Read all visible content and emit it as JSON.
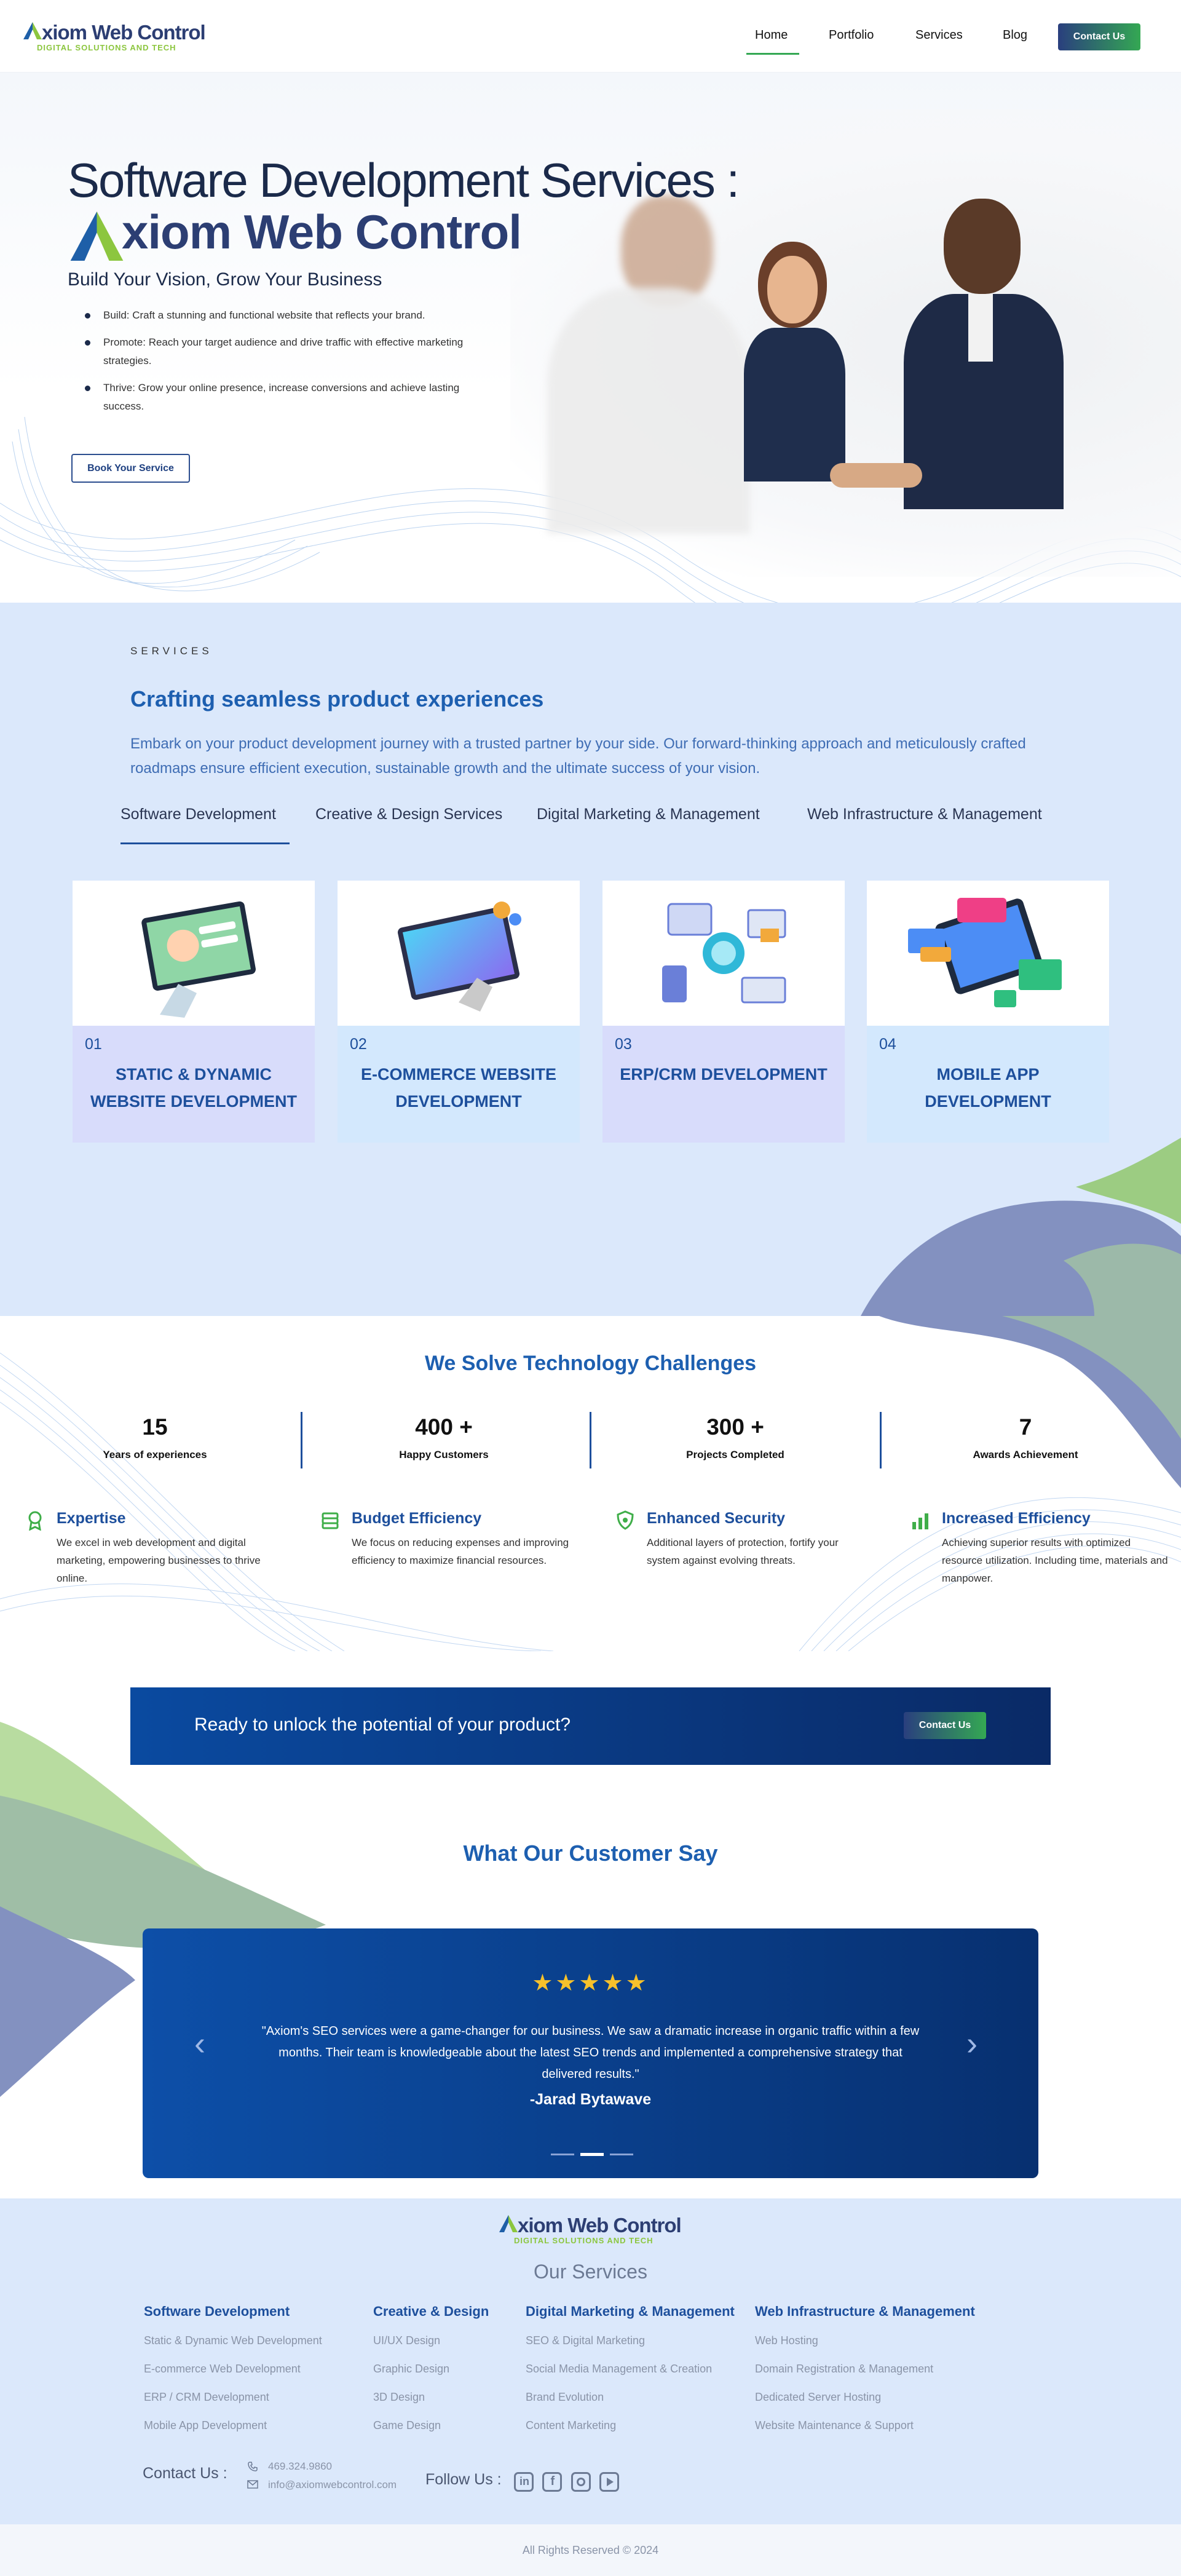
{
  "brand": {
    "name_first": "A",
    "name_rest": "xiom Web Control",
    "tagline": "DIGITAL SOLUTIONS AND TECH"
  },
  "nav": {
    "items": [
      "Home",
      "Portfolio",
      "Services",
      "Blog"
    ],
    "active": "Home",
    "contact_label": "Contact Us"
  },
  "hero": {
    "title_line1": "Software Development Services :",
    "title_brand": "xiom Web Control",
    "subtitle": "Build Your Vision, Grow Your Business",
    "bullets": [
      "Build: Craft a stunning and functional website that reflects your brand.",
      "Promote: Reach your target audience and drive traffic with effective marketing strategies.",
      "Thrive: Grow your online presence, increase conversions and achieve lasting success."
    ],
    "button": "Book Your Service"
  },
  "services": {
    "eyebrow": "SERVICES",
    "heading": "Crafting seamless product experiences",
    "description": "Embark on your product development journey with a trusted partner by your side. Our forward-thinking approach and meticulously crafted roadmaps ensure efficient execution, sustainable growth and the ultimate success of your vision.",
    "tabs": [
      "Software Development",
      "Creative & Design Services",
      "Digital Marketing & Management",
      "Web Infrastructure & Management"
    ],
    "active_tab": "Software Development",
    "cards": [
      {
        "num": "01",
        "title": "STATIC & DYNAMIC WEBSITE DEVELOPMENT",
        "bg": "#d8dcfb"
      },
      {
        "num": "02",
        "title": "E-COMMERCE WEBSITE DEVELOPMENT",
        "bg": "#d3e8fd"
      },
      {
        "num": "03",
        "title": "ERP/CRM DEVELOPMENT",
        "bg": "#d8dcfb"
      },
      {
        "num": "04",
        "title": "MOBILE APP DEVELOPMENT",
        "bg": "#d3e8fd"
      }
    ]
  },
  "challenges": {
    "heading": "We Solve Technology Challenges",
    "stats": [
      {
        "value": "15",
        "label": "Years of experiences"
      },
      {
        "value": "400 +",
        "label": "Happy Customers"
      },
      {
        "value": "300 +",
        "label": "Projects Completed"
      },
      {
        "value": "7",
        "label": "Awards Achievement"
      }
    ],
    "features": [
      {
        "title": "Expertise",
        "desc": "We excel in web development and digital marketing, empowering businesses to thrive online.",
        "icon": "ribbon-icon"
      },
      {
        "title": "Budget Efficiency",
        "desc": "We focus on reducing expenses and improving efficiency to maximize financial resources.",
        "icon": "money-icon"
      },
      {
        "title": "Enhanced Security",
        "desc": "Additional layers of protection, fortify your system against evolving threats.",
        "icon": "shield-icon"
      },
      {
        "title": "Increased Efficiency",
        "desc": "Achieving superior results with optimized resource utilization. Including time, materials and manpower.",
        "icon": "chart-icon"
      }
    ]
  },
  "cta": {
    "text": "Ready to unlock the potential of your product?",
    "button": "Contact Us"
  },
  "testimonials": {
    "heading": "What Our Customer Say",
    "stars": "★★★★★",
    "quote": "\"Axiom's SEO services were a game-changer for our business. We saw a dramatic increase in organic traffic within a few months. Their team is knowledgeable about the latest SEO trends and implemented a comprehensive strategy that delivered results.\"",
    "author": "-Jarad Bytawave",
    "prev": "‹",
    "next": "›"
  },
  "footer": {
    "heading": "Our Services",
    "columns": [
      {
        "title": "Software Development",
        "items": [
          "Static & Dynamic Web Development",
          "E-commerce Web Development",
          "ERP / CRM Development",
          "Mobile App Development"
        ]
      },
      {
        "title": "Creative & Design",
        "items": [
          "UI/UX Design",
          "Graphic Design",
          "3D Design",
          "Game Design"
        ]
      },
      {
        "title": "Digital Marketing & Management",
        "items": [
          "SEO & Digital Marketing",
          "Social Media Management & Creation",
          "Brand Evolution",
          "Content Marketing"
        ]
      },
      {
        "title": "Web Infrastructure & Management",
        "items": [
          "Web Hosting",
          "Domain Registration & Management",
          "Dedicated Server Hosting",
          "Website Maintenance & Support"
        ]
      }
    ],
    "contact_label": "Contact Us :",
    "phone": "469.324.9860",
    "email": "info@axiomwebcontrol.com",
    "follow_label": "Follow Us :",
    "copyright": "All Rights Reserved © 2024"
  },
  "colors": {
    "brand_blue": "#1d4f9c",
    "brand_green": "#8cc63f",
    "navy": "#2c3e73"
  }
}
